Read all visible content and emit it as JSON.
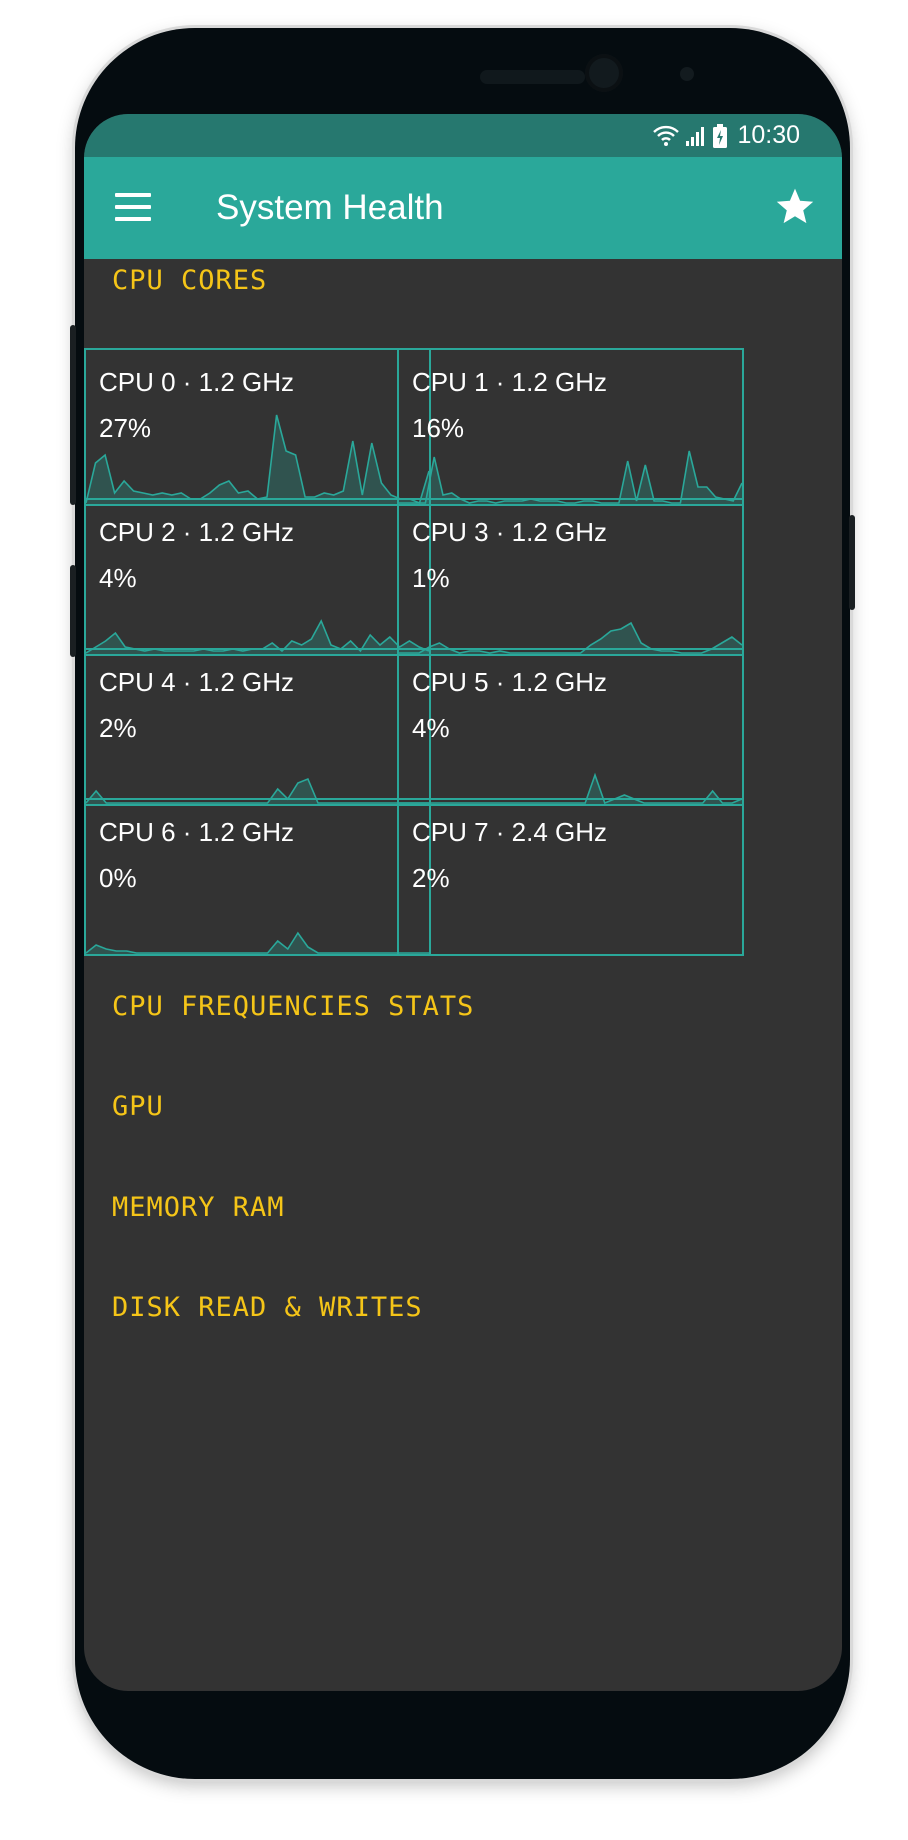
{
  "colors": {
    "accent": "#2aa89a",
    "status_bar": "#26786f",
    "background": "#333333",
    "section_title": "#f5c518"
  },
  "status_bar": {
    "time": "10:30",
    "icons": [
      "wifi-icon",
      "signal-icon",
      "battery-charging-icon"
    ]
  },
  "toolbar": {
    "title": "System Health",
    "menu_icon": "menu-icon",
    "favorite_icon": "star-icon"
  },
  "sections": {
    "cpu_cores": "CPU CORES",
    "cpu_frequencies": "CPU FREQUENCIES STATS",
    "gpu": "GPU",
    "memory": "MEMORY RAM",
    "disk": "DISK READ & WRITES"
  },
  "cpu_cores": [
    {
      "label": "CPU 0 · 1.2 GHz",
      "usage": "27%",
      "history": [
        0,
        40,
        48,
        10,
        22,
        12,
        10,
        8,
        10,
        8,
        10,
        4,
        4,
        10,
        18,
        22,
        10,
        12,
        4,
        6,
        88,
        52,
        48,
        6,
        6,
        10,
        8,
        12,
        62,
        8,
        60,
        20,
        8,
        4,
        4,
        0,
        32
      ]
    },
    {
      "label": "CPU 1 · 1.2 GHz",
      "usage": "16%",
      "history": [
        0,
        0,
        0,
        0,
        46,
        8,
        10,
        4,
        0,
        2,
        2,
        0,
        2,
        2,
        2,
        4,
        2,
        2,
        2,
        0,
        0,
        2,
        2,
        0,
        0,
        0,
        42,
        2,
        38,
        2,
        2,
        0,
        0,
        52,
        16,
        16,
        6,
        4,
        2,
        20
      ]
    },
    {
      "label": "CPU 2 · 1.2 GHz",
      "usage": "4%",
      "history": [
        0,
        6,
        12,
        20,
        6,
        4,
        2,
        4,
        2,
        2,
        2,
        2,
        4,
        2,
        2,
        4,
        2,
        4,
        4,
        10,
        2,
        12,
        8,
        14,
        32,
        8,
        4,
        12,
        2,
        18,
        8,
        16,
        6,
        12,
        6,
        2
      ]
    },
    {
      "label": "CPU 3 · 1.2 GHz",
      "usage": "1%",
      "history": [
        0,
        0,
        0,
        6,
        10,
        4,
        0,
        2,
        2,
        0,
        2,
        0,
        0,
        0,
        0,
        0,
        0,
        0,
        0,
        8,
        14,
        22,
        24,
        30,
        10,
        4,
        2,
        2,
        0,
        0,
        0,
        4,
        10,
        16,
        8
      ]
    },
    {
      "label": "CPU 4 · 1.2 GHz",
      "usage": "2%",
      "history": [
        0,
        12,
        0,
        0,
        0,
        0,
        0,
        0,
        0,
        0,
        0,
        0,
        0,
        0,
        0,
        0,
        0,
        0,
        0,
        14,
        4,
        20,
        24,
        0,
        0,
        0,
        0,
        0,
        0,
        0,
        0,
        0,
        0,
        0,
        0
      ]
    },
    {
      "label": "CPU 5 · 1.2 GHz",
      "usage": "4%",
      "history": [
        0,
        0,
        0,
        0,
        0,
        0,
        0,
        0,
        0,
        0,
        0,
        0,
        0,
        0,
        0,
        0,
        0,
        0,
        0,
        0,
        28,
        0,
        4,
        8,
        4,
        0,
        0,
        0,
        0,
        0,
        0,
        0,
        12,
        0,
        0,
        4
      ]
    },
    {
      "label": "CPU 6 · 1.2 GHz",
      "usage": "0%",
      "history": [
        0,
        8,
        4,
        2,
        2,
        0,
        0,
        0,
        0,
        0,
        0,
        0,
        0,
        0,
        0,
        0,
        0,
        0,
        0,
        12,
        4,
        20,
        6,
        0,
        0,
        0,
        0,
        0,
        0,
        0,
        0,
        0,
        0,
        0,
        0
      ]
    },
    {
      "label": "CPU 7 · 2.4 GHz",
      "usage": "2%",
      "history": []
    }
  ]
}
